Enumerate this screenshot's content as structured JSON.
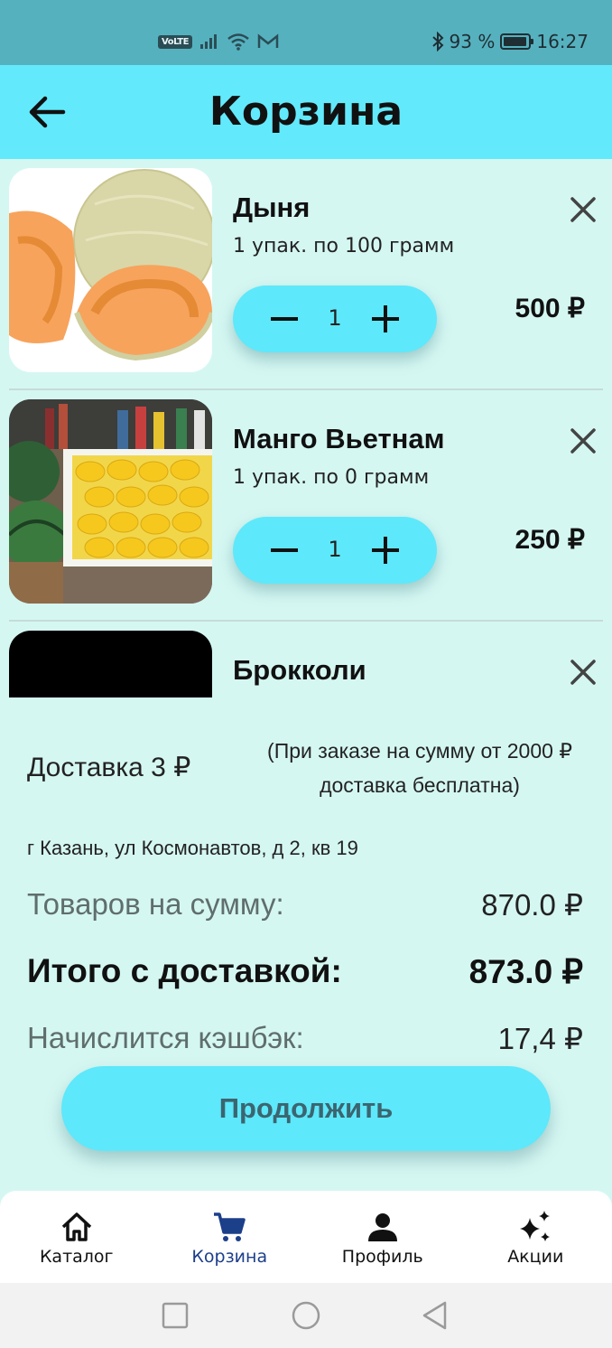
{
  "status_bar": {
    "volte": "VoLTE",
    "battery_percent": "93 %",
    "time": "16:27"
  },
  "app_bar": {
    "title": "Корзина",
    "back_icon": "arrow-left-icon"
  },
  "cart": {
    "items": [
      {
        "name": "Дыня",
        "pack": "1 упак. по 100 грамм",
        "quantity": "1",
        "price": "500 ₽",
        "image": "melon"
      },
      {
        "name": "Манго Вьетнам",
        "pack": "1 упак. по 0 грамм",
        "quantity": "1",
        "price": "250 ₽",
        "image": "mango-crate"
      },
      {
        "name": "Брокколи",
        "image": "black-placeholder"
      }
    ]
  },
  "summary": {
    "delivery_label": "Доставка 3 ₽",
    "delivery_note": "(При заказе на сумму от 2000 ₽ доставка бесплатна)",
    "address": "г Казань, ул Космонавтов, д 2, кв 19",
    "goods_label": "Товаров на сумму:",
    "goods_value": "870.0 ₽",
    "total_label": "Итого с доставкой:",
    "total_value": "873.0 ₽",
    "cashback_label": "Начислится кэшбэк:",
    "cashback_value": "17,4 ₽",
    "continue_label": "Продолжить"
  },
  "bottom_nav": {
    "items": [
      {
        "label": "Каталог",
        "icon": "home-icon"
      },
      {
        "label": "Корзина",
        "icon": "cart-icon",
        "active": true
      },
      {
        "label": "Профиль",
        "icon": "person-icon"
      },
      {
        "label": "Акции",
        "icon": "sparkle-icon"
      }
    ]
  },
  "colors": {
    "status_bar": "#56b1bf",
    "app_bar": "#62eafc",
    "background": "#d5f7f2",
    "accent": "#5ee8fb",
    "active_nav": "#1c3f8a"
  }
}
